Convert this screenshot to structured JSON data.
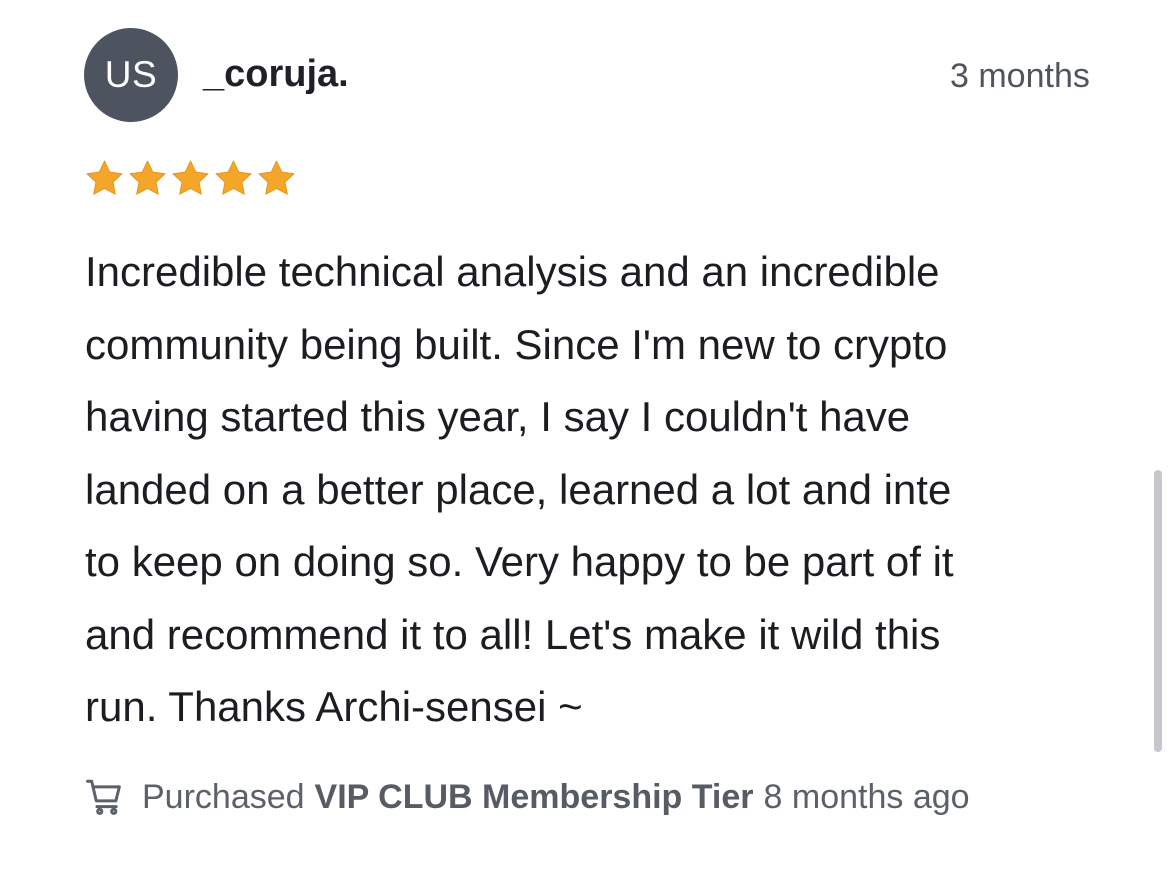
{
  "review": {
    "avatar_initials": "US",
    "username": "_coruja.",
    "time": "3 months",
    "rating": 5,
    "rating_max": 5,
    "star_color": "#f4a62a",
    "body_lines": [
      "Incredible technical analysis and an incredible",
      "community being built. Since I'm new to crypto",
      "having started this year, I say I couldn't have",
      "landed on a better place, learned a lot and inte",
      "to keep on doing so. Very happy to be part of it",
      "and recommend it to all! Let's make it wild this",
      "run. Thanks Archi-sensei ~"
    ],
    "purchase": {
      "icon": "shopping-cart-icon",
      "prefix": "Purchased",
      "product": "VIP CLUB Membership Tier",
      "when": "8 months ago"
    }
  }
}
